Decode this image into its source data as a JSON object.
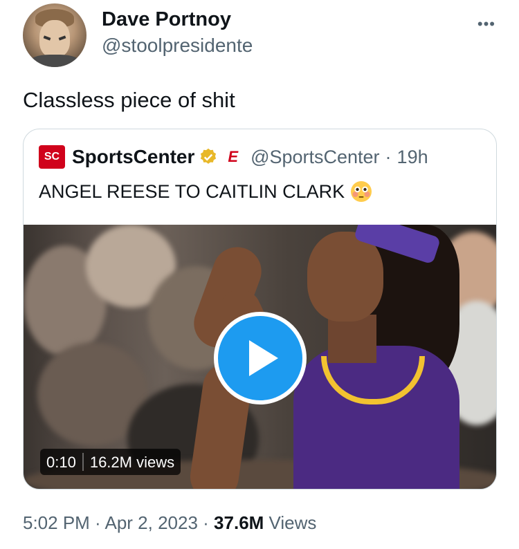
{
  "author": {
    "display_name": "Dave Portnoy",
    "handle": "@stoolpresidente",
    "avatar": "avatar-photo"
  },
  "more_icon": "more-horizontal-icon",
  "tweet": {
    "text": "Classless piece of shit"
  },
  "quoted_tweet": {
    "logo_text": "SC",
    "name": "SportsCenter",
    "verified_icon": "gold-verified-badge-icon",
    "affiliate_icon": "espn-e-icon",
    "affiliate_text": "E",
    "handle": "@SportsCenter",
    "separator": "·",
    "time": "19h",
    "text": "ANGEL REESE TO CAITLIN CLARK",
    "emoji": "flushed-face-emoji",
    "video": {
      "play_icon": "play-icon",
      "duration": "0:10",
      "views": "16.2M views"
    }
  },
  "meta": {
    "time": "5:02 PM",
    "dot1": " · ",
    "date": "Apr 2, 2023",
    "dot2": " · ",
    "views_count": "37.6M",
    "views_label": " Views"
  },
  "colors": {
    "text_primary": "#0f1419",
    "text_secondary": "#536471",
    "border": "#cfd9de",
    "accent_blue": "#1d9bf0",
    "espn_red": "#d0021b",
    "verified_gold": "#e8b829"
  }
}
